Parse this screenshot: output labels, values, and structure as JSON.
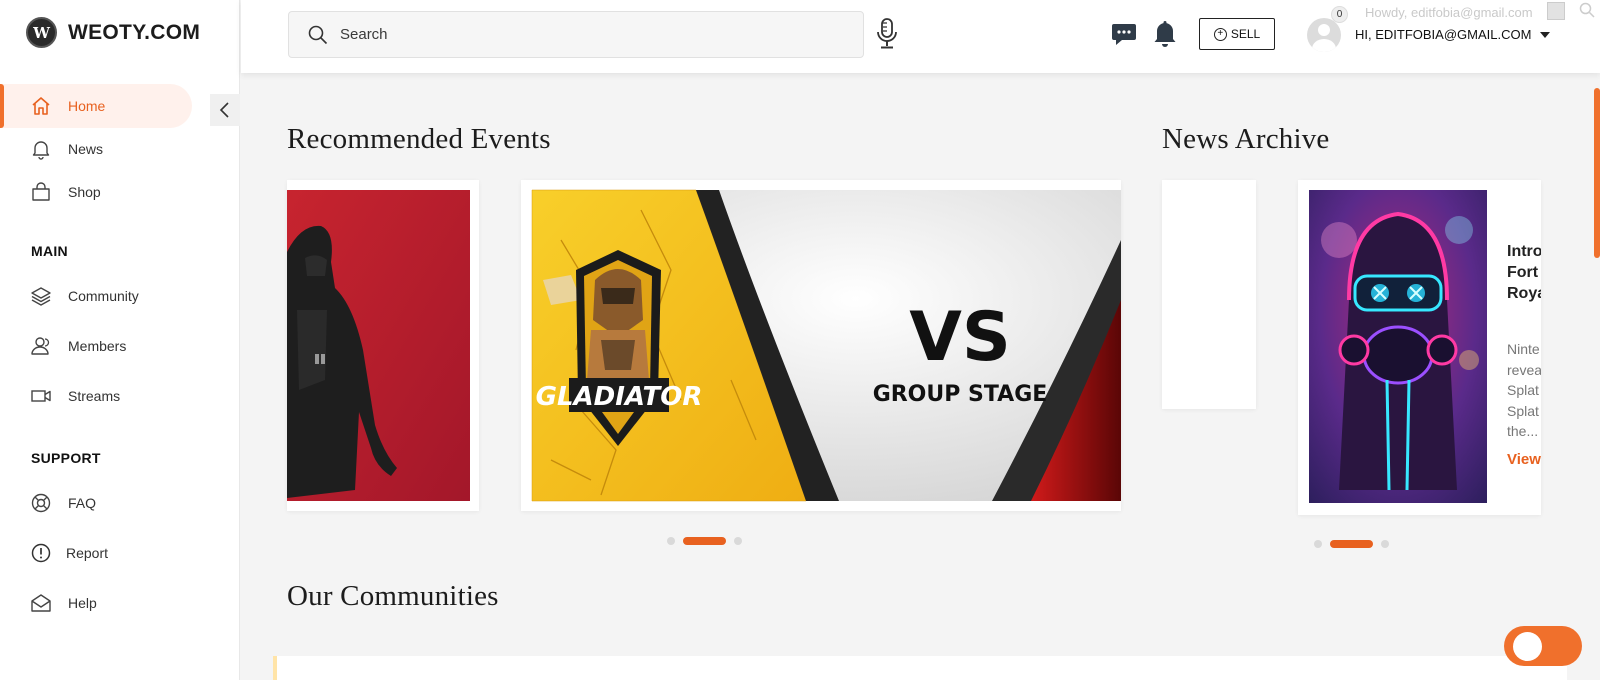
{
  "brand": {
    "name": "WEOTY.COM",
    "logo_letter": "W"
  },
  "sidebar": {
    "primary": [
      {
        "label": "Home",
        "icon": "home-icon",
        "active": true
      },
      {
        "label": "News",
        "icon": "bell-icon"
      },
      {
        "label": "Shop",
        "icon": "shopping-bag-icon"
      }
    ],
    "main_heading": "MAIN",
    "main": [
      {
        "label": "Community",
        "icon": "layers-icon"
      },
      {
        "label": "Members",
        "icon": "members-icon"
      },
      {
        "label": "Streams",
        "icon": "video-camera-icon"
      }
    ],
    "support_heading": "SUPPORT",
    "support": [
      {
        "label": "FAQ",
        "icon": "lifebuoy-icon"
      },
      {
        "label": "Report",
        "icon": "alert-circle-icon"
      },
      {
        "label": "Help",
        "icon": "mail-open-icon"
      }
    ]
  },
  "header": {
    "search_placeholder": "Search",
    "sell_label": "SELL",
    "notification_count": "0",
    "user_greeting": "HI, EDITFOBIA@GMAIL.COM",
    "howdy_text": "Howdy, editfobia@gmail.com"
  },
  "main": {
    "recommended_title": "Recommended Events",
    "news_archive_title": "News Archive",
    "communities_title": "Our Communities",
    "event_banner": {
      "logo_text": "GLADIATOR",
      "vs_text": "VS",
      "stage_text": "GROUP STAGE"
    },
    "news_item": {
      "title": "Intro\nFort\nRoya",
      "excerpt": "Ninte\nrevea\nSplat\nSplat\nthe...",
      "view_label": "View"
    }
  },
  "colors": {
    "accent": "#e8611f",
    "accent_light": "#fff1ec",
    "event_yellow": "#f6c21a",
    "event_red": "#b11d2b"
  }
}
